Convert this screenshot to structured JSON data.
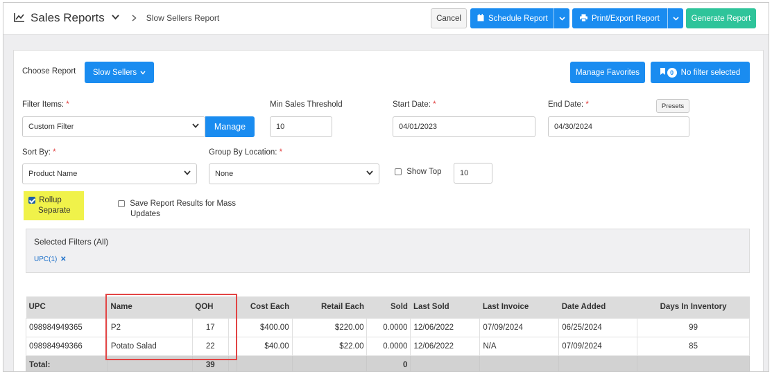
{
  "header": {
    "title": "Sales Reports",
    "subtitle": "Slow Sellers Report",
    "cancel_label": "Cancel",
    "schedule_label": "Schedule Report",
    "print_label": "Print/Export Report",
    "generate_label": "Generate Report"
  },
  "report": {
    "choose_label": "Choose Report",
    "choose_value": "Slow Sellers",
    "manage_favorites_label": "Manage Favorites",
    "filter_count": "0",
    "filter_status": "No filter selected"
  },
  "form": {
    "filter_items_label": "Filter Items:",
    "filter_items_value": "Custom Filter",
    "manage_label": "Manage",
    "min_sales_label": "Min Sales Threshold",
    "min_sales_value": "10",
    "start_date_label": "Start Date:",
    "start_date_value": "04/01/2023",
    "end_date_label": "End Date:",
    "end_date_value": "04/30/2024",
    "presets_label": "Presets",
    "sort_by_label": "Sort By:",
    "sort_by_value": "Product Name",
    "group_by_label": "Group By Location:",
    "group_by_value": "None",
    "show_top_label": "Show Top",
    "show_top_value": "10",
    "rollup_line1": "Rollup",
    "rollup_line2": "Separate",
    "save_results_line1": "Save Report Results for Mass",
    "save_results_line2": "Updates",
    "required_mark": "*"
  },
  "selected_filters": {
    "title": "Selected Filters (All)",
    "tag": "UPC(1)",
    "remove_glyph": "✕"
  },
  "table": {
    "headers": [
      "UPC",
      "Name",
      "QOH",
      "",
      "Cost Each",
      "Retail Each",
      "Sold",
      "Last Sold",
      "Last Invoice",
      "Date Added",
      "Days In Inventory"
    ],
    "rows": [
      [
        "098984949365",
        "P2",
        "17",
        "",
        "$400.00",
        "$220.00",
        "0.0000",
        "12/06/2022",
        "07/09/2024",
        "06/25/2024",
        "99"
      ],
      [
        "098984949366",
        "Potato Salad",
        "22",
        "",
        "$40.00",
        "$22.00",
        "0.0000",
        "12/06/2022",
        "N/A",
        "07/09/2024",
        "85"
      ]
    ],
    "total": [
      "Total:",
      "",
      "39",
      "",
      "",
      "",
      "0",
      "",
      "",
      "",
      ""
    ]
  },
  "colors": {
    "accent": "#1a8cf0",
    "generate": "#2ec49a",
    "highlight": "#f0f24a",
    "annotation": "#e24444"
  },
  "icons": [
    "chart-line-icon",
    "chevron-down-icon",
    "chevron-right-icon",
    "calendar-icon",
    "printer-icon",
    "bookmark-icon",
    "close-icon"
  ]
}
